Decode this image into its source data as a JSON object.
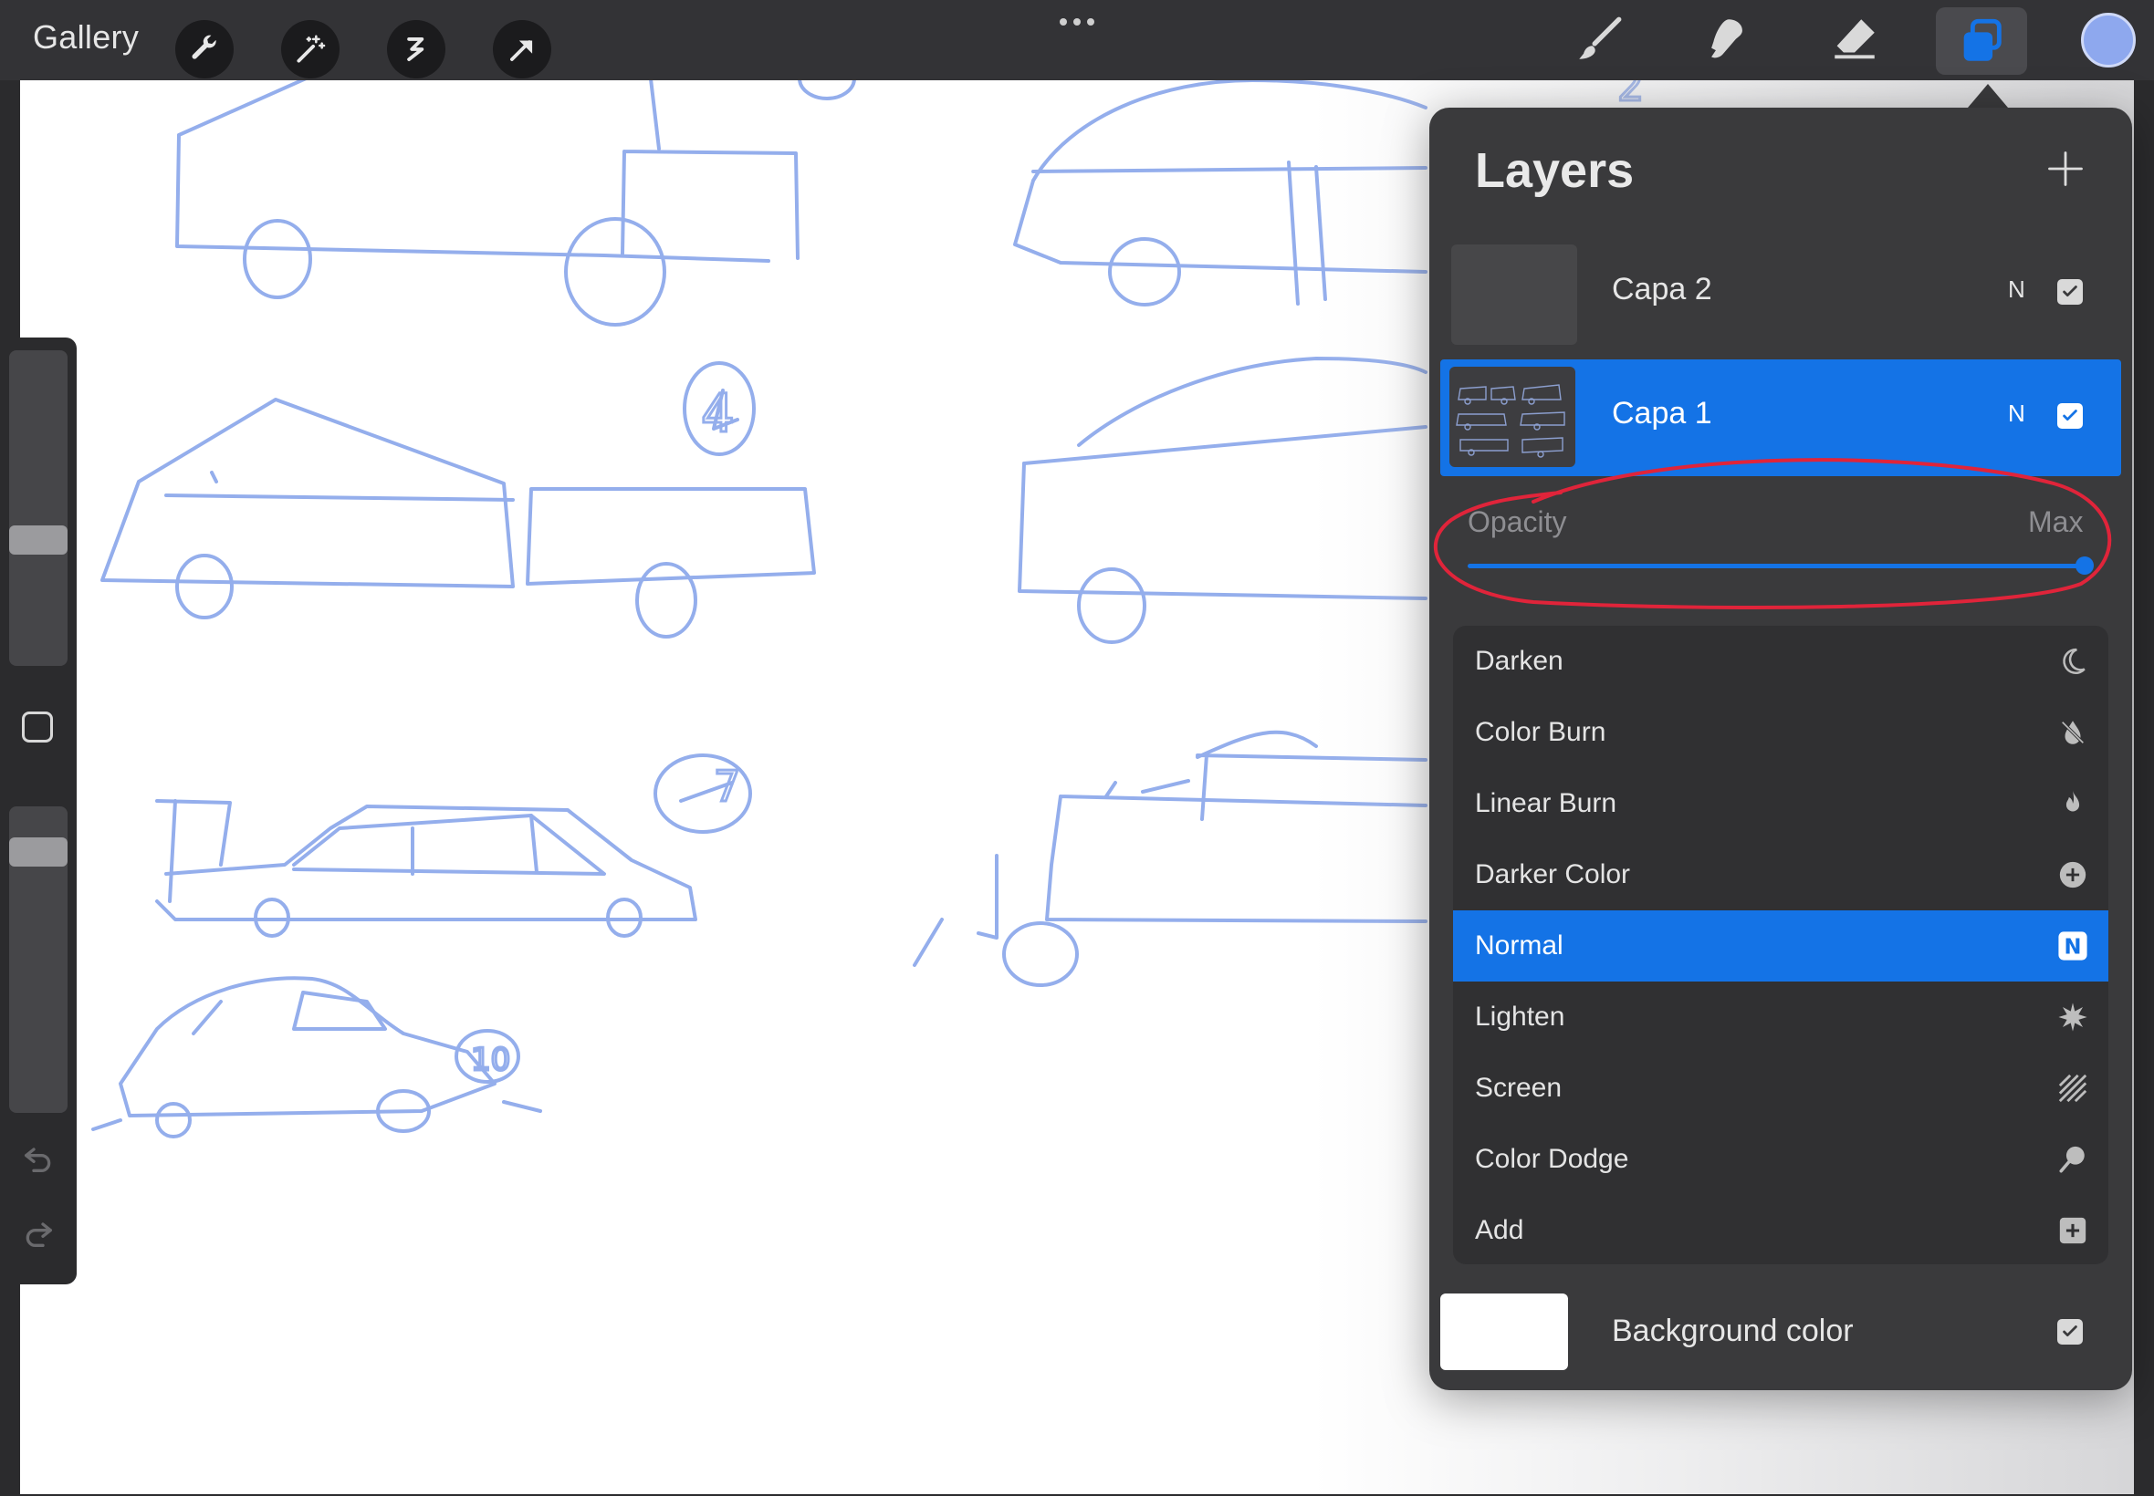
{
  "app": {
    "gallery_label": "Gallery",
    "toolbar_left": [
      "wrench-icon",
      "magic-wand-icon",
      "selection-icon",
      "transform-arrow-icon"
    ],
    "toolbar_right": [
      "brush-icon",
      "smudge-icon",
      "eraser-icon",
      "layers-icon"
    ],
    "color_current": "#8ea8ee",
    "accent": "#1473e6"
  },
  "layers_panel": {
    "title": "Layers",
    "layers": [
      {
        "name": "Capa 2",
        "mode": "N",
        "visible": true,
        "selected": false
      },
      {
        "name": "Capa 1",
        "mode": "N",
        "visible": true,
        "selected": true
      }
    ],
    "opacity": {
      "label": "Opacity",
      "value_label": "Max",
      "value": 1.0
    },
    "blend_modes": [
      {
        "label": "Darken",
        "icon": "moon-icon"
      },
      {
        "label": "Color Burn",
        "icon": "burn-drop-icon"
      },
      {
        "label": "Linear Burn",
        "icon": "flame-icon"
      },
      {
        "label": "Darker Color",
        "icon": "plus-circle-icon"
      },
      {
        "label": "Normal",
        "icon": "n-badge-icon",
        "selected": true,
        "badge": "N"
      },
      {
        "label": "Lighten",
        "icon": "sun-burst-icon"
      },
      {
        "label": "Screen",
        "icon": "stripes-icon"
      },
      {
        "label": "Color Dodge",
        "icon": "dodge-icon"
      },
      {
        "label": "Add",
        "icon": "plus-square-icon"
      }
    ],
    "background": {
      "label": "Background color",
      "color": "#ffffff",
      "visible": true
    }
  },
  "canvas": {
    "sketch_numbers": [
      "2",
      "4",
      "7",
      "10"
    ],
    "stroke_color": "#94aeec",
    "annotation_color": "#e0243a"
  }
}
